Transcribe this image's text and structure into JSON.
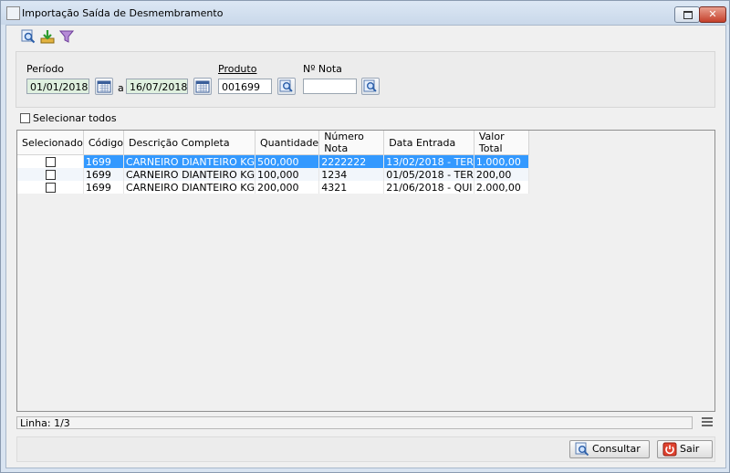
{
  "window": {
    "title": "Importação Saída de Desmembramento"
  },
  "toolbar": {
    "icons": [
      "search-icon",
      "import-icon",
      "filter-icon"
    ]
  },
  "filters": {
    "periodo_label": "Período",
    "data_inicial": "01/01/2018",
    "separator": "a",
    "data_final": "16/07/2018",
    "produto_label": "Produto",
    "produto_value": "001699",
    "nota_label": "Nº Nota",
    "nota_value": ""
  },
  "select_all": {
    "label": "Selecionar todos",
    "checked": false
  },
  "table": {
    "columns": [
      "Selecionado",
      "Código",
      "Descrição Completa",
      "Quantidade",
      "Número Nota",
      "Data Entrada",
      "Valor Total"
    ],
    "rows": [
      {
        "selecionado": false,
        "codigo": "1699",
        "descricao": "CARNEIRO DIANTEIRO KG",
        "quantidade": "500,000",
        "numero_nota": "2222222",
        "data_entrada": "13/02/2018 - TER",
        "valor_total": "1.000,00"
      },
      {
        "selecionado": false,
        "codigo": "1699",
        "descricao": "CARNEIRO DIANTEIRO KG",
        "quantidade": "100,000",
        "numero_nota": "1234",
        "data_entrada": "01/05/2018 - TER",
        "valor_total": "200,00"
      },
      {
        "selecionado": false,
        "codigo": "1699",
        "descricao": "CARNEIRO DIANTEIRO KG",
        "quantidade": "200,000",
        "numero_nota": "4321",
        "data_entrada": "21/06/2018 - QUI",
        "valor_total": "2.000,00"
      }
    ],
    "selected_row": 0
  },
  "status": {
    "linha": "Linha: 1/3"
  },
  "buttons": {
    "consultar": "Consultar",
    "sair": "Sair"
  },
  "colors": {
    "selection": "#3399ff",
    "date_field": "#dff0df",
    "sair_icon": "#e0422f"
  }
}
